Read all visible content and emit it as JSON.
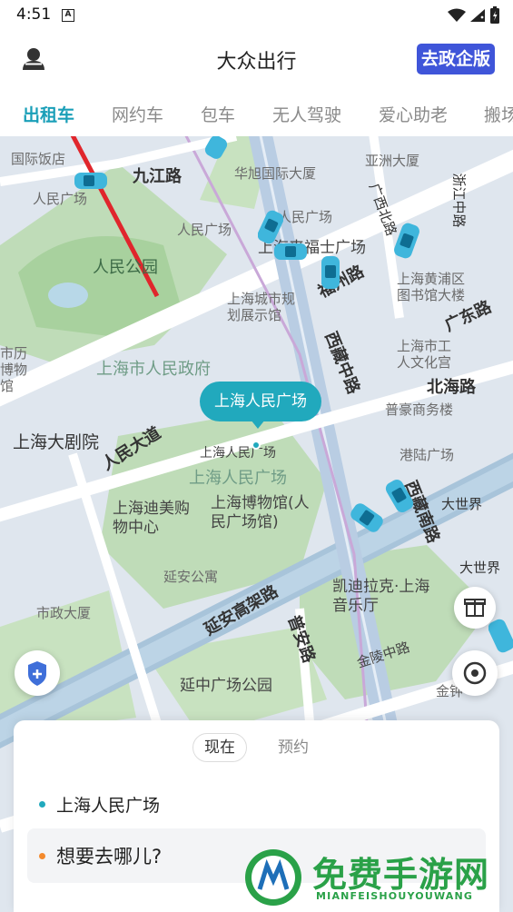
{
  "status_bar": {
    "time": "4:51",
    "notif_icon_letter": "A"
  },
  "header": {
    "title": "大众出行",
    "gov_button_label": "去政企版"
  },
  "tabs": [
    {
      "label": "出租车",
      "active": true
    },
    {
      "label": "网约车",
      "active": false
    },
    {
      "label": "包车",
      "active": false
    },
    {
      "label": "无人驾驶",
      "active": false
    },
    {
      "label": "爱心助老",
      "active": false
    },
    {
      "label": "搬场",
      "active": false
    }
  ],
  "map": {
    "pin_label": "上海人民广场",
    "labels": {
      "l1": "国际饭店",
      "l2": "九江路",
      "l3": "人民广场",
      "l4": "华旭国际大厦",
      "l5": "亚洲大厦",
      "l6": "人民公园",
      "l7": "人民广场",
      "l8": "人民广场",
      "l9": "上海来福士广场",
      "l10": "上海城市规划展示馆",
      "l11": "上海黄浦区图书馆大楼",
      "l12": "广东路",
      "l13": "上海市人民政府",
      "l14": "上海市工人文化宫",
      "l15": "北海路",
      "l16": "普豪商务楼",
      "l17": "上海大剧院",
      "l18": "人民大道",
      "l19": "上海人民广场",
      "l20": "上海人民广场",
      "l21": "港陆广场",
      "l22": "上海迪美购物中心",
      "l23": "上海博物馆(人民广场馆)",
      "l24": "大世界",
      "l25": "延安公寓",
      "l26": "市政大厦",
      "l27": "延安高架路",
      "l28": "凯迪拉克·上海音乐厅",
      "l29": "普安路",
      "l30": "延中广场公园",
      "l31": "金陵中路",
      "l32": "西藏中路",
      "l33": "西藏南路",
      "l34": "浙江中路",
      "l35": "广西北路",
      "l36": "福州路",
      "l37": "大世界",
      "l38": "市历博物馆",
      "l39": "金钟"
    }
  },
  "booking": {
    "time_tabs": [
      "现在",
      "预约"
    ],
    "origin": "上海人民广场",
    "destination_placeholder": "想要去哪儿?"
  },
  "watermark": {
    "title": "免费手游网",
    "subtitle": "MIANFEISHOUYOUWANG"
  },
  "colors": {
    "accent": "#1a9fb8",
    "gov_button": "#3f55d9",
    "annotation_arrow": "#e0262c"
  }
}
